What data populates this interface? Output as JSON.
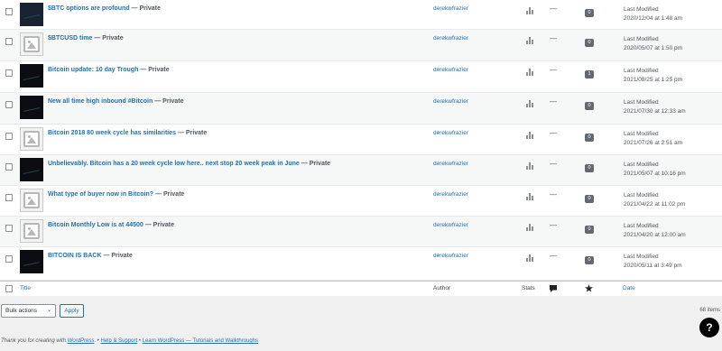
{
  "posts": [
    {
      "title": "$BTC options are profound",
      "state": "Private",
      "author": "derekwfrazier",
      "comments": "0",
      "date_label": "Last Modified",
      "date": "2020/12/04 at 1:48 am",
      "thumb": "dark-blue"
    },
    {
      "title": "$BTCUSD time",
      "state": "Private",
      "author": "derekwfrazier",
      "comments": "0",
      "date_label": "Last Modified",
      "date": "2020/05/07 at 1:50 pm",
      "thumb": "placeholder"
    },
    {
      "title": "Bitcoin update: 10 day Trough",
      "state": "Private",
      "author": "derekwfrazier",
      "comments": "1",
      "date_label": "Last Modified",
      "date": "2021/08/25 at 1:25 pm",
      "thumb": "dark"
    },
    {
      "title": "New all time high inbound #Bitcoin",
      "state": "Private",
      "author": "derekwfrazier",
      "comments": "0",
      "date_label": "Last Modified",
      "date": "2021/07/30 at 12:33 am",
      "thumb": "dark"
    },
    {
      "title": "Bitcoin 2018 80 week cycle has similarities",
      "state": "Private",
      "author": "derekwfrazier",
      "comments": "0",
      "date_label": "Last Modified",
      "date": "2021/07/26 at 2:51 am",
      "thumb": "placeholder"
    },
    {
      "title": "Unbelievably. Bitcoin has a 20 week cycle low here.. next stop 20 week peak in June",
      "state": "Private",
      "author": "derekwfrazier",
      "comments": "0",
      "date_label": "Last Modified",
      "date": "2021/05/07 at 10:16 pm",
      "thumb": "dark"
    },
    {
      "title": "What type of buyer now in Bitcoin?",
      "state": "Private",
      "author": "derekwfrazier",
      "comments": "0",
      "date_label": "Last Modified",
      "date": "2021/04/22 at 11:02 pm",
      "thumb": "placeholder"
    },
    {
      "title": "Bitcoin Monthly Low is at 44500",
      "state": "Private",
      "author": "derekwfrazier",
      "comments": "0",
      "date_label": "Last Modified",
      "date": "2021/04/20 at 12:00 am",
      "thumb": "placeholder"
    },
    {
      "title": "BITCOIN IS BACK",
      "state": "Private",
      "author": "derekwfrazier",
      "comments": "0",
      "date_label": "Last Modified",
      "date": "2020/05/11 at 3:49 pm",
      "thumb": "dark"
    }
  ],
  "separator": "—",
  "stat_dash": "—",
  "columns": {
    "title": "Title",
    "author": "Author",
    "stats": "Stats",
    "date": "Date",
    "comments_icon": "comment-bubble-icon",
    "likes_icon": "star-icon"
  },
  "bulk_actions": {
    "selected": "Bulk actions",
    "apply": "Apply"
  },
  "items_count": "68 items",
  "footer": {
    "thanks_prefix": "Thank you for creating with ",
    "wordpress_link": "WordPress",
    "sep1": ". • ",
    "help_link": "Help & Support",
    "sep2": " • ",
    "learn_link": "Learn WordPress — Tutorials and Walkthroughs"
  },
  "help_button": "?",
  "colors": {
    "link": "#2271b1",
    "badge": "#646970",
    "alt_row": "#f6f7f7"
  }
}
